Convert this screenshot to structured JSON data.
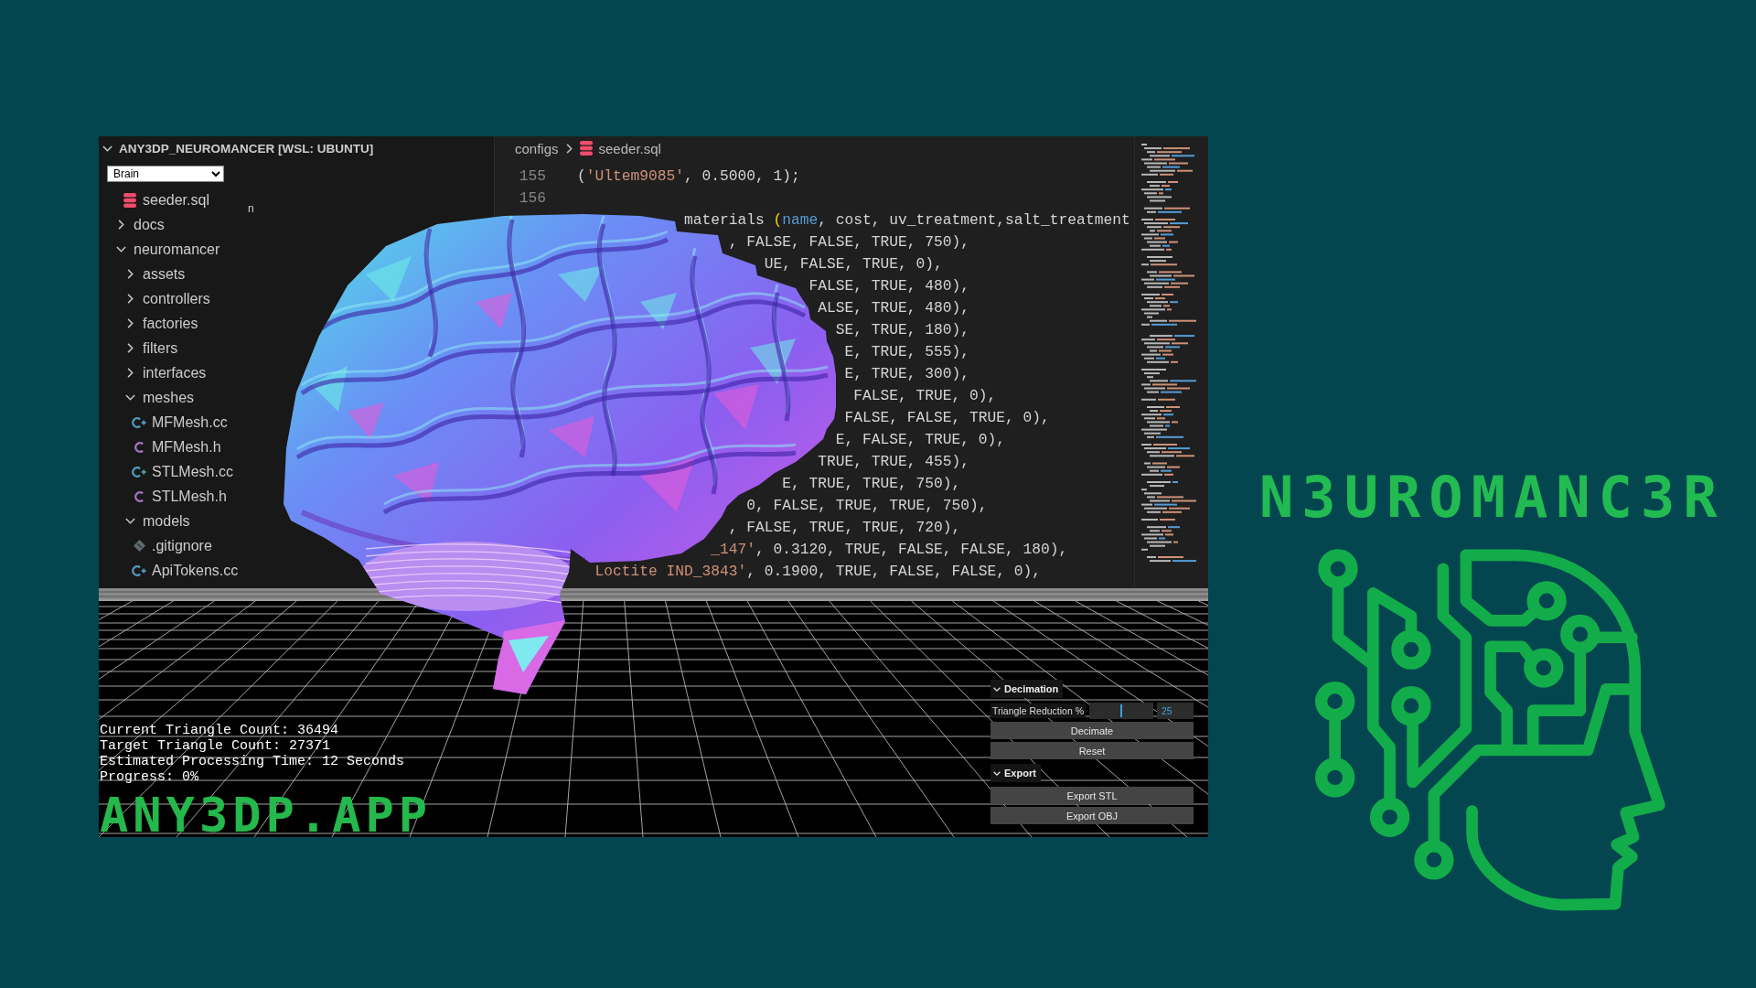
{
  "explorer": {
    "title": "ANY3DP_NEUROMANCER [WSL: UBUNTU]",
    "expanded": true,
    "model_select": {
      "value": "Brain"
    },
    "partial_text": "n",
    "tree": [
      {
        "children": [
          {
            "name": "seeder.sql",
            "kind": "sql"
          }
        ]
      },
      {
        "name": "docs",
        "kind": "folder",
        "expanded": false
      },
      {
        "name": "neuromancer",
        "kind": "folder",
        "expanded": true,
        "children": [
          {
            "name": "assets",
            "kind": "folder",
            "expanded": false
          },
          {
            "name": "controllers",
            "kind": "folder",
            "expanded": false
          },
          {
            "name": "factories",
            "kind": "folder",
            "expanded": false
          },
          {
            "name": "filters",
            "kind": "folder",
            "expanded": false
          },
          {
            "name": "interfaces",
            "kind": "folder",
            "expanded": false
          },
          {
            "name": "meshes",
            "kind": "folder",
            "expanded": true,
            "children": [
              {
                "name": "MFMesh.cc",
                "kind": "cpp"
              },
              {
                "name": "MFMesh.h",
                "kind": "header"
              },
              {
                "name": "STLMesh.cc",
                "kind": "cpp"
              },
              {
                "name": "STLMesh.h",
                "kind": "header"
              }
            ]
          },
          {
            "name": "models",
            "kind": "folder",
            "expanded": true,
            "children": [
              {
                "name": ".gitignore",
                "kind": "git"
              },
              {
                "name": "ApiTokens.cc",
                "kind": "cpp"
              }
            ]
          }
        ]
      }
    ]
  },
  "editor": {
    "breadcrumb": [
      {
        "label": "configs",
        "kind": "folder"
      },
      {
        "label": "seeder.sql",
        "kind": "sql"
      }
    ],
    "lines": [
      {
        "number": "155",
        "tokens": [
          {
            "text": "(",
            "kind": "plain"
          },
          {
            "text": "'Ultem9085'",
            "kind": "string"
          },
          {
            "text": ", 0.5000, 1);",
            "kind": "plain"
          }
        ]
      },
      {
        "number": "156"
      },
      {
        "tokens": [
          {
            "text": "materials ",
            "kind": "plain"
          },
          {
            "text": "(",
            "kind": "bracket"
          },
          {
            "text": "name",
            "kind": "keyword"
          },
          {
            "text": ", cost, uv_treatment,salt_treatment",
            "kind": "plain"
          }
        ]
      },
      {
        "tokens": [
          {
            "text": ", FALSE, FALSE, TRUE, 750),",
            "kind": "plain"
          }
        ]
      },
      {
        "tokens": [
          {
            "text": "UE, FALSE, TRUE, 0),",
            "kind": "plain"
          }
        ]
      },
      {
        "tokens": [
          {
            "text": "FALSE, TRUE, 480),",
            "kind": "plain"
          }
        ]
      },
      {
        "tokens": [
          {
            "text": "ALSE, TRUE, 480),",
            "kind": "plain"
          }
        ]
      },
      {
        "tokens": [
          {
            "text": "SE, TRUE, 180),",
            "kind": "plain"
          }
        ]
      },
      {
        "tokens": [
          {
            "text": "E, TRUE, 555),",
            "kind": "plain"
          }
        ]
      },
      {
        "tokens": [
          {
            "text": "E, TRUE, 300),",
            "kind": "plain"
          }
        ]
      },
      {
        "tokens": [
          {
            "text": "FALSE, TRUE, 0),",
            "kind": "plain"
          }
        ]
      },
      {
        "tokens": [
          {
            "text": "FALSE, FALSE, TRUE, 0),",
            "kind": "plain"
          }
        ]
      },
      {
        "tokens": [
          {
            "text": "E, FALSE, TRUE, 0),",
            "kind": "plain"
          }
        ]
      },
      {
        "tokens": [
          {
            "text": "TRUE, TRUE, 455),",
            "kind": "plain"
          }
        ]
      },
      {
        "tokens": [
          {
            "text": "E, TRUE, TRUE, 750),",
            "kind": "plain"
          }
        ]
      },
      {
        "tokens": [
          {
            "text": "0, FALSE, TRUE, TRUE, 750),",
            "kind": "plain"
          }
        ]
      },
      {
        "tokens": [
          {
            "text": ", FALSE, TRUE, TRUE, 720),",
            "kind": "plain"
          }
        ]
      },
      {
        "tokens": [
          {
            "text": "_147'",
            "kind": "string"
          },
          {
            "text": ", 0.3120, TRUE, FALSE, FALSE, 180),",
            "kind": "plain"
          }
        ]
      },
      {
        "tokens": [
          {
            "text": "Loctite IND_3843'",
            "kind": "string"
          },
          {
            "text": ", 0.1900, TRUE, FALSE, FALSE, 0),",
            "kind": "plain"
          }
        ]
      }
    ]
  },
  "viewport": {
    "stats": [
      "Current Triangle Count: 36494",
      "Target Triangle Count: 27371",
      "Estimated Processing Time: 12 Seconds",
      "Progress: 0%"
    ],
    "brand": "ANY3DP.APP",
    "gui": {
      "folders": [
        {
          "title": "Decimation",
          "expanded": true,
          "controls": [
            {
              "kind": "slider",
              "label": "Triangle Reduction %",
              "level": 0.5,
              "value": "25"
            },
            {
              "kind": "button",
              "label": "Decimate"
            },
            {
              "kind": "button",
              "label": "Reset"
            }
          ]
        },
        {
          "title": "Export",
          "expanded": true,
          "controls": [
            {
              "kind": "button",
              "label": "Export STL"
            },
            {
              "kind": "button",
              "label": "Export OBJ"
            }
          ]
        }
      ]
    }
  },
  "logo": {
    "title": "N3UROMANC3R"
  }
}
